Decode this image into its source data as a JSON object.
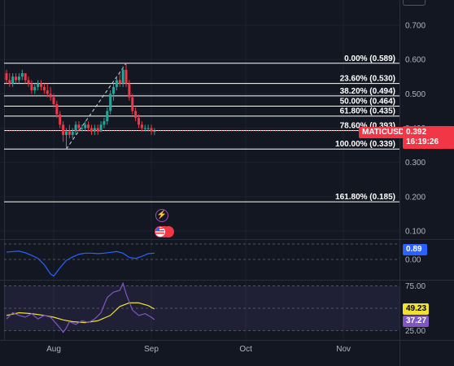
{
  "symbol": "MATICUSD",
  "last_price": "0.392",
  "countdown": "16:19:26",
  "colors": {
    "background": "#131722",
    "up": "#26a69a",
    "down": "#f23645",
    "macd_line": "#2962ff",
    "rsi_line": "#7e57c2",
    "rsi_ma": "#f0e130",
    "fib_line": "#ffffff"
  },
  "price_axis": [
    "0.700",
    "0.600",
    "0.500",
    "0.400",
    "0.300",
    "0.200",
    "0.100"
  ],
  "time_axis": [
    "Aug",
    "Sep",
    "Oct",
    "Nov"
  ],
  "macd_axis": [
    "0.00"
  ],
  "macd_value": "0.89",
  "rsi_axis": [
    "75.00",
    "25.00"
  ],
  "rsi_values": {
    "ma": "49.23",
    "rsi": "37.27"
  },
  "fib_levels": [
    {
      "label": "0.00% (0.589)",
      "price": 0.589
    },
    {
      "label": "23.60% (0.530)",
      "price": 0.53
    },
    {
      "label": "38.20% (0.494)",
      "price": 0.494
    },
    {
      "label": "50.00% (0.464)",
      "price": 0.464
    },
    {
      "label": "61.80% (0.435)",
      "price": 0.435
    },
    {
      "label": "78.60% (0.393)",
      "price": 0.393
    },
    {
      "label": "100.00% (0.339)",
      "price": 0.339
    },
    {
      "label": "161.80% (0.185)",
      "price": 0.185
    }
  ],
  "icons": {
    "event_dividend": "bolt-icon",
    "event_economic": "us-flag-icon"
  },
  "chart_data": {
    "type": "candlestick",
    "price_range": [
      0.05,
      0.72
    ],
    "x_range_days": [
      -15,
      120
    ],
    "x_ticks": [
      {
        "label": "Aug",
        "day": 0
      },
      {
        "label": "Sep",
        "day": 31
      },
      {
        "label": "Oct",
        "day": 61
      },
      {
        "label": "Nov",
        "day": 92
      }
    ],
    "trend_line": {
      "from": {
        "day": 4,
        "price": 0.339
      },
      "to": {
        "day": 23,
        "price": 0.589
      }
    },
    "candles": [
      {
        "day": -15,
        "o": 0.56,
        "h": 0.57,
        "l": 0.53,
        "c": 0.54
      },
      {
        "day": -14,
        "o": 0.54,
        "h": 0.56,
        "l": 0.52,
        "c": 0.53
      },
      {
        "day": -13,
        "o": 0.53,
        "h": 0.56,
        "l": 0.52,
        "c": 0.55
      },
      {
        "day": -12,
        "o": 0.55,
        "h": 0.56,
        "l": 0.53,
        "c": 0.54
      },
      {
        "day": -11,
        "o": 0.54,
        "h": 0.56,
        "l": 0.53,
        "c": 0.55
      },
      {
        "day": -10,
        "o": 0.55,
        "h": 0.57,
        "l": 0.54,
        "c": 0.56
      },
      {
        "day": -9,
        "o": 0.56,
        "h": 0.56,
        "l": 0.53,
        "c": 0.54
      },
      {
        "day": -8,
        "o": 0.54,
        "h": 0.55,
        "l": 0.52,
        "c": 0.53
      },
      {
        "day": -7,
        "o": 0.53,
        "h": 0.54,
        "l": 0.5,
        "c": 0.51
      },
      {
        "day": -6,
        "o": 0.51,
        "h": 0.53,
        "l": 0.5,
        "c": 0.52
      },
      {
        "day": -5,
        "o": 0.52,
        "h": 0.54,
        "l": 0.51,
        "c": 0.53
      },
      {
        "day": -4,
        "o": 0.53,
        "h": 0.54,
        "l": 0.51,
        "c": 0.52
      },
      {
        "day": -3,
        "o": 0.52,
        "h": 0.53,
        "l": 0.5,
        "c": 0.51
      },
      {
        "day": -2,
        "o": 0.51,
        "h": 0.53,
        "l": 0.49,
        "c": 0.5
      },
      {
        "day": -1,
        "o": 0.5,
        "h": 0.52,
        "l": 0.48,
        "c": 0.49
      },
      {
        "day": 0,
        "o": 0.49,
        "h": 0.5,
        "l": 0.46,
        "c": 0.47
      },
      {
        "day": 1,
        "o": 0.47,
        "h": 0.48,
        "l": 0.43,
        "c": 0.44
      },
      {
        "day": 2,
        "o": 0.44,
        "h": 0.45,
        "l": 0.4,
        "c": 0.41
      },
      {
        "day": 3,
        "o": 0.41,
        "h": 0.42,
        "l": 0.36,
        "c": 0.38
      },
      {
        "day": 4,
        "o": 0.38,
        "h": 0.4,
        "l": 0.34,
        "c": 0.39
      },
      {
        "day": 5,
        "o": 0.39,
        "h": 0.41,
        "l": 0.37,
        "c": 0.38
      },
      {
        "day": 6,
        "o": 0.38,
        "h": 0.4,
        "l": 0.37,
        "c": 0.39
      },
      {
        "day": 7,
        "o": 0.39,
        "h": 0.42,
        "l": 0.38,
        "c": 0.41
      },
      {
        "day": 8,
        "o": 0.41,
        "h": 0.42,
        "l": 0.39,
        "c": 0.4
      },
      {
        "day": 9,
        "o": 0.4,
        "h": 0.41,
        "l": 0.39,
        "c": 0.4
      },
      {
        "day": 10,
        "o": 0.4,
        "h": 0.42,
        "l": 0.39,
        "c": 0.41
      },
      {
        "day": 11,
        "o": 0.41,
        "h": 0.42,
        "l": 0.39,
        "c": 0.4
      },
      {
        "day": 12,
        "o": 0.4,
        "h": 0.41,
        "l": 0.38,
        "c": 0.39
      },
      {
        "day": 13,
        "o": 0.39,
        "h": 0.41,
        "l": 0.38,
        "c": 0.4
      },
      {
        "day": 14,
        "o": 0.4,
        "h": 0.41,
        "l": 0.38,
        "c": 0.39
      },
      {
        "day": 15,
        "o": 0.39,
        "h": 0.42,
        "l": 0.39,
        "c": 0.41
      },
      {
        "day": 16,
        "o": 0.41,
        "h": 0.43,
        "l": 0.4,
        "c": 0.42
      },
      {
        "day": 17,
        "o": 0.42,
        "h": 0.46,
        "l": 0.41,
        "c": 0.45
      },
      {
        "day": 18,
        "o": 0.45,
        "h": 0.51,
        "l": 0.44,
        "c": 0.5
      },
      {
        "day": 19,
        "o": 0.5,
        "h": 0.53,
        "l": 0.48,
        "c": 0.52
      },
      {
        "day": 20,
        "o": 0.52,
        "h": 0.55,
        "l": 0.51,
        "c": 0.54
      },
      {
        "day": 21,
        "o": 0.54,
        "h": 0.56,
        "l": 0.52,
        "c": 0.53
      },
      {
        "day": 22,
        "o": 0.53,
        "h": 0.58,
        "l": 0.52,
        "c": 0.57
      },
      {
        "day": 23,
        "o": 0.57,
        "h": 0.589,
        "l": 0.52,
        "c": 0.53
      },
      {
        "day": 24,
        "o": 0.53,
        "h": 0.54,
        "l": 0.48,
        "c": 0.49
      },
      {
        "day": 25,
        "o": 0.49,
        "h": 0.5,
        "l": 0.44,
        "c": 0.45
      },
      {
        "day": 26,
        "o": 0.45,
        "h": 0.46,
        "l": 0.42,
        "c": 0.43
      },
      {
        "day": 27,
        "o": 0.43,
        "h": 0.44,
        "l": 0.4,
        "c": 0.41
      },
      {
        "day": 28,
        "o": 0.41,
        "h": 0.42,
        "l": 0.39,
        "c": 0.4
      },
      {
        "day": 29,
        "o": 0.4,
        "h": 0.41,
        "l": 0.39,
        "c": 0.4
      },
      {
        "day": 30,
        "o": 0.4,
        "h": 0.41,
        "l": 0.39,
        "c": 0.4
      },
      {
        "day": 31,
        "o": 0.4,
        "h": 0.41,
        "l": 0.38,
        "c": 0.39
      },
      {
        "day": 32,
        "o": 0.39,
        "h": 0.4,
        "l": 0.38,
        "c": 0.392
      }
    ],
    "macd_range": [
      -0.9,
      0.9
    ],
    "macd": [
      [
        -15,
        0.35
      ],
      [
        -13,
        0.38
      ],
      [
        -11,
        0.4
      ],
      [
        -9,
        0.32
      ],
      [
        -7,
        0.2
      ],
      [
        -5,
        0.05
      ],
      [
        -3,
        -0.25
      ],
      [
        -1,
        -0.7
      ],
      [
        0,
        -0.8
      ],
      [
        2,
        -0.4
      ],
      [
        4,
        -0.05
      ],
      [
        6,
        0.12
      ],
      [
        8,
        0.25
      ],
      [
        10,
        0.3
      ],
      [
        12,
        0.3
      ],
      [
        14,
        0.28
      ],
      [
        16,
        0.3
      ],
      [
        18,
        0.34
      ],
      [
        20,
        0.38
      ],
      [
        22,
        0.3
      ],
      [
        24,
        0.1
      ],
      [
        26,
        0.05
      ],
      [
        28,
        0.15
      ],
      [
        30,
        0.28
      ],
      [
        32,
        0.3
      ]
    ],
    "rsi_range": [
      20,
      80
    ],
    "rsi": [
      [
        -15,
        38
      ],
      [
        -13,
        45
      ],
      [
        -11,
        42
      ],
      [
        -9,
        40
      ],
      [
        -7,
        44
      ],
      [
        -5,
        38
      ],
      [
        -3,
        42
      ],
      [
        -1,
        40
      ],
      [
        1,
        32
      ],
      [
        2,
        28
      ],
      [
        3,
        23
      ],
      [
        4,
        28
      ],
      [
        5,
        35
      ],
      [
        7,
        32
      ],
      [
        9,
        36
      ],
      [
        11,
        34
      ],
      [
        13,
        38
      ],
      [
        15,
        45
      ],
      [
        17,
        62
      ],
      [
        19,
        68
      ],
      [
        21,
        70
      ],
      [
        22,
        78
      ],
      [
        23,
        66
      ],
      [
        25,
        48
      ],
      [
        27,
        42
      ],
      [
        29,
        44
      ],
      [
        31,
        40
      ],
      [
        32,
        37.27
      ]
    ],
    "rsi_ma": [
      [
        -15,
        42
      ],
      [
        -11,
        45
      ],
      [
        -7,
        44
      ],
      [
        -3,
        42
      ],
      [
        0,
        40
      ],
      [
        3,
        37
      ],
      [
        6,
        35
      ],
      [
        10,
        34
      ],
      [
        14,
        36
      ],
      [
        18,
        42
      ],
      [
        21,
        52
      ],
      [
        24,
        56
      ],
      [
        27,
        56
      ],
      [
        30,
        53
      ],
      [
        32,
        49.23
      ]
    ]
  }
}
